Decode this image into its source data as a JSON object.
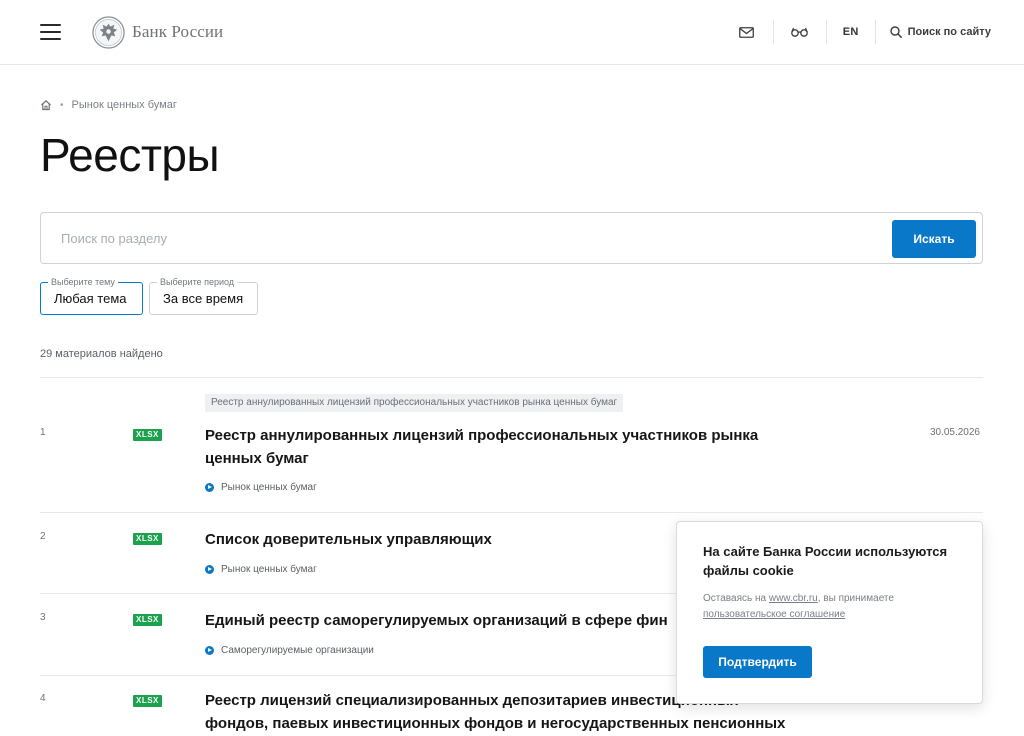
{
  "header": {
    "logo_text": "Банк России",
    "lang": "EN",
    "site_search_label": "Поиск по сайту",
    "icons": [
      "menu-icon",
      "bank-emblem-icon",
      "mail-icon",
      "glasses-icon",
      "search-icon"
    ]
  },
  "breadcrumb": {
    "items": [
      "Рынок ценных бумаг"
    ]
  },
  "page": {
    "title": "Реестры"
  },
  "search": {
    "placeholder": "Поиск по разделу",
    "button_label": "Искать"
  },
  "filters": [
    {
      "legend": "Выберите тему",
      "value": "Любая тема"
    },
    {
      "legend": "Выберите период",
      "value": "За все время"
    }
  ],
  "results": {
    "count_text": "29 материалов найдено",
    "items": [
      {
        "num": "1",
        "format": "XLSX",
        "tag": "Реестр аннулированных лицензий профессиональных участников рынка ценных бумаг",
        "title": "Реестр аннулированных лицензий профессиональных участников рынка ценных бумаг",
        "category": "Рынок ценных бумаг",
        "date": "30.05.2026"
      },
      {
        "num": "2",
        "format": "XLSX",
        "title": "Список доверительных управляющих",
        "category": "Рынок ценных бумаг"
      },
      {
        "num": "3",
        "format": "XLSX",
        "title": "Единый реестр саморегулируемых организаций в сфере фин",
        "category": "Саморегулируемые организации"
      },
      {
        "num": "4",
        "format": "XLSX",
        "title": "Реестр лицензий специализированных депозитариев инвестиционных фондов, паевых инвестиционных фондов и негосударственных пенсионных"
      }
    ]
  },
  "cookie": {
    "title": "На сайте Банка России используются файлы cookie",
    "text_before": "Оставаясь на ",
    "link_site": "www.cbr.ru",
    "text_middle": ", вы принимаете ",
    "link_agreement": "пользовательское соглашение",
    "button_label": "Подтвердить"
  },
  "colors": {
    "accent": "#0a78c8",
    "badge_green": "#1aa24c",
    "text_muted": "#7b8087"
  }
}
